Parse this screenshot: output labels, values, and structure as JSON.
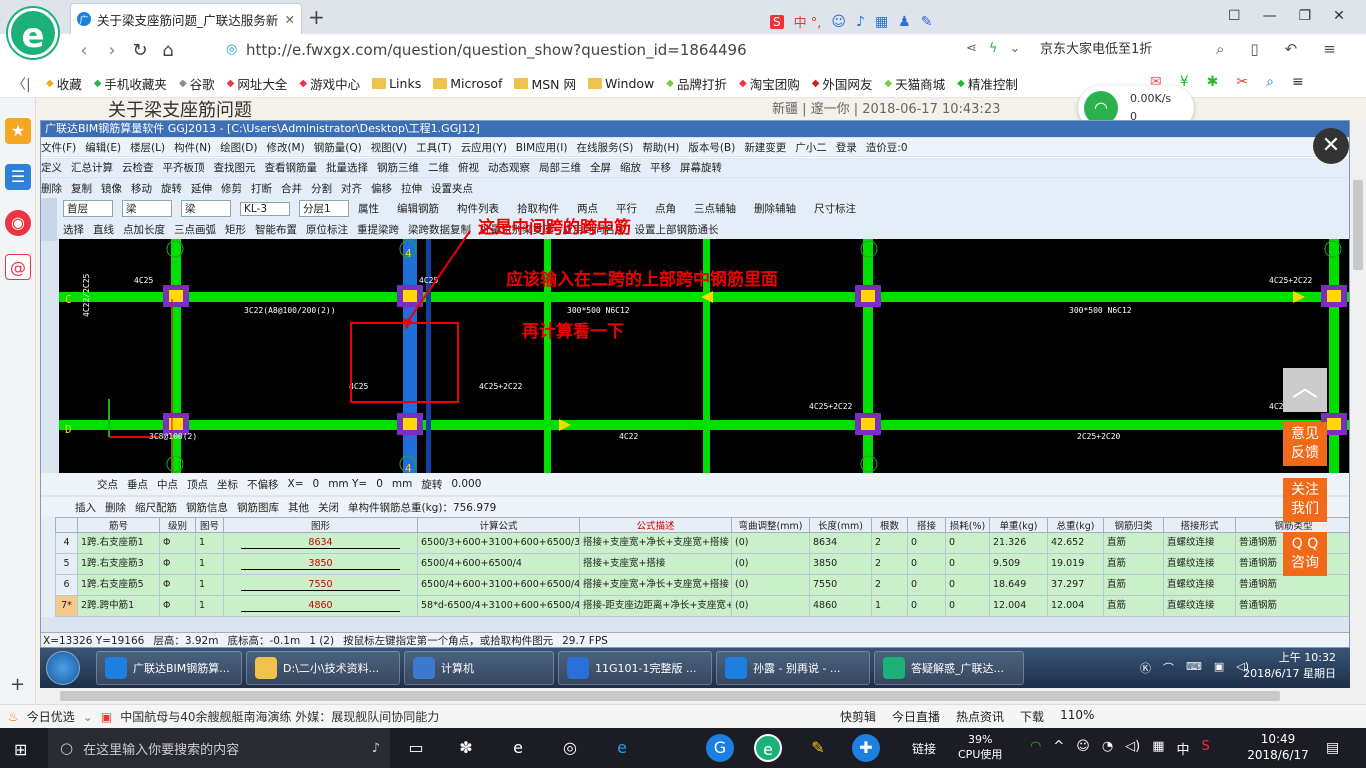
{
  "browser": {
    "tab_title": "关于梁支座筋问题_广联达服务新",
    "url": "http://e.fwxgx.com/question/question_show?question_id=1864496",
    "search_text": "京东大家电低至1折",
    "ime_text": "中 °,",
    "bookmarks": [
      "收藏",
      "手机收藏夹",
      "谷歌",
      "网址大全",
      "游戏中心",
      "Links",
      "Microsof",
      "MSN 网",
      "Window",
      "品牌打折",
      "淘宝团购",
      "外国网友",
      "天猫商城",
      "精准控制"
    ]
  },
  "page": {
    "title": "关于梁支座筋问题",
    "meta": "新疆 | 邃一你 | 2018-06-17 10:43:23",
    "net_speed_down": "0.00K/s",
    "net_speed_up": "0",
    "side_buttons": [
      "意见\n反馈",
      "关注\n我们",
      "Q Q\n咨询"
    ]
  },
  "app": {
    "title": "广联达BIM钢筋算量软件 GGJ2013 - [C:\\Users\\Administrator\\Desktop\\工程1.GGJ12]",
    "menu": [
      "文件(F)",
      "编辑(E)",
      "楼层(L)",
      "构件(N)",
      "绘图(D)",
      "修改(M)",
      "钢筋量(Q)",
      "视图(V)",
      "工具(T)",
      "云应用(Y)",
      "BIM应用(I)",
      "在线服务(S)",
      "帮助(H)",
      "版本号(B)",
      "新建变更",
      "广小二",
      "登录",
      "造价豆:0"
    ],
    "toolbar1": [
      "定义",
      "汇总计算",
      "云检查",
      "平齐板顶",
      "查找图元",
      "查看钢筋量",
      "批量选择",
      "钢筋三维",
      "二维",
      "俯视",
      "动态观察",
      "局部三维",
      "全屏",
      "缩放",
      "平移",
      "屏幕旋转"
    ],
    "toolbar2": [
      "删除",
      "复制",
      "镜像",
      "移动",
      "旋转",
      "延伸",
      "修剪",
      "打断",
      "合并",
      "分割",
      "对齐",
      "偏移",
      "拉伸",
      "设置夹点"
    ],
    "toolbar3": {
      "floor": "首层",
      "type1": "梁",
      "type2": "梁",
      "element": "KL-3",
      "layer": "分层1",
      "buttons": [
        "属性",
        "编辑钢筋",
        "构件列表",
        "拾取构件",
        "两点",
        "平行",
        "点角",
        "三点辅轴",
        "删除辅轴",
        "尺寸标注"
      ]
    },
    "toolbar4": [
      "选择",
      "直线",
      "点加长度",
      "三点画弧",
      "矩形",
      "智能布置",
      "原位标注",
      "重提梁跨",
      "梁跨数据复制",
      "批量识别梁支座",
      "应用到同名梁",
      "设置上部钢筋通长"
    ],
    "cad_labels": [
      "4C25",
      "4C22/2C25",
      "3C22(A8@100/200(2))",
      "4C25",
      "300*500 N6C12",
      "4C25+2C22",
      "300*500 N6C12",
      "4C25+2C22",
      "4C25",
      "4C22",
      "2C25+2C20",
      "3C8@100(2)",
      "4C25+2C22",
      "4C25+2C22"
    ],
    "axis_labels": [
      "4",
      "4",
      "C",
      "D"
    ],
    "annotations": [
      "这是中间跨的跨中筋",
      "应该输入在二跨的上部跨中钢筋里面",
      "再计算看一下"
    ],
    "snap": [
      "交点",
      "垂点",
      "中点",
      "顶点",
      "坐标",
      "不偏移",
      "X=",
      "0",
      "mm Y=",
      "0",
      "mm",
      "旋转",
      "0.000"
    ],
    "grid_toolbar": [
      "插入",
      "删除",
      "缩尺配筋",
      "钢筋信息",
      "钢筋图库",
      "其他",
      "关闭",
      "单构件钢筋总重(kg)：756.979"
    ],
    "columns": [
      "筋号",
      "级别",
      "图号",
      "图形",
      "计算公式",
      "公式描述",
      "弯曲调整(mm)",
      "长度(mm)",
      "根数",
      "搭接",
      "损耗(%)",
      "单重(kg)",
      "总重(kg)",
      "钢筋归类",
      "搭接形式",
      "钢筋类型"
    ],
    "rows": [
      {
        "num": "4",
        "name": "1跨.右支座筋1",
        "grade": "Φ",
        "fig": "1",
        "shape": "8634",
        "formula": "6500/3+600+3100+600+6500/3",
        "desc": "搭接+支座宽+净长+支座宽+搭接",
        "bend": "(0)",
        "len": "8634",
        "count": "2",
        "lap": "0",
        "loss": "0",
        "unit": "21.326",
        "total": "42.652",
        "cat": "直筋",
        "lapform": "直螺纹连接",
        "type": "普通钢筋"
      },
      {
        "num": "5",
        "name": "1跨.右支座筋3",
        "grade": "Φ",
        "fig": "1",
        "shape": "3850",
        "formula": "6500/4+600+6500/4",
        "desc": "搭接+支座宽+搭接",
        "bend": "(0)",
        "len": "3850",
        "count": "2",
        "lap": "0",
        "loss": "0",
        "unit": "9.509",
        "total": "19.019",
        "cat": "直筋",
        "lapform": "直螺纹连接",
        "type": "普通钢筋"
      },
      {
        "num": "6",
        "name": "1跨.右支座筋5",
        "grade": "Φ",
        "fig": "1",
        "shape": "7550",
        "formula": "6500/4+600+3100+600+6500/4",
        "desc": "搭接+支座宽+净长+支座宽+搭接",
        "bend": "(0)",
        "len": "7550",
        "count": "2",
        "lap": "0",
        "loss": "0",
        "unit": "18.649",
        "total": "37.297",
        "cat": "直筋",
        "lapform": "直螺纹连接",
        "type": "普通钢筋"
      },
      {
        "num": "7*",
        "name": "2跨.跨中筋1",
        "grade": "Φ",
        "fig": "1",
        "shape": "4860",
        "formula": "58*d-6500/4+3100+600+6500/4",
        "desc": "搭接-距支座边距离+净长+支座宽+搭接",
        "bend": "(0)",
        "len": "4860",
        "count": "1",
        "lap": "0",
        "loss": "0",
        "unit": "12.004",
        "total": "12.004",
        "cat": "直筋",
        "lapform": "直螺纹连接",
        "type": "普通钢筋"
      }
    ],
    "status": [
      "X=13326 Y=19166",
      "层高：3.92m",
      "底标高：-0.1m",
      "1 (2)",
      "按鼠标左键指定第一个角点，或拾取构件图元",
      "29.7 FPS"
    ]
  },
  "win7_taskbar": {
    "items": [
      "广联达BIM钢筋算...",
      "D:\\二小\\技术资料...",
      "计算机",
      "11G101-1完整版 ...",
      "孙露 - 别再说 - ...",
      "答疑解惑_广联达..."
    ],
    "time": "上午 10:32",
    "date": "2018/6/17 星期日"
  },
  "news": {
    "label": "今日优选",
    "headline": "中国航母与40余艘舰艇南海演练 外媒：展现舰队间协同能力",
    "items": [
      "快剪辑",
      "今日直播",
      "热点资讯",
      "下载",
      "110%"
    ]
  },
  "win10_taskbar": {
    "search_placeholder": "在这里输入你要搜索的内容",
    "link_label": "链接",
    "cpu_pct": "39%",
    "cpu_label": "CPU使用",
    "ime": "中",
    "time": "10:49",
    "date": "2018/6/17"
  },
  "colors": {
    "beam_green": "#00e000",
    "column_purple": "#7b2fbe",
    "highlight_blue": "#1e6fd9",
    "annotation_red": "#e00000"
  }
}
